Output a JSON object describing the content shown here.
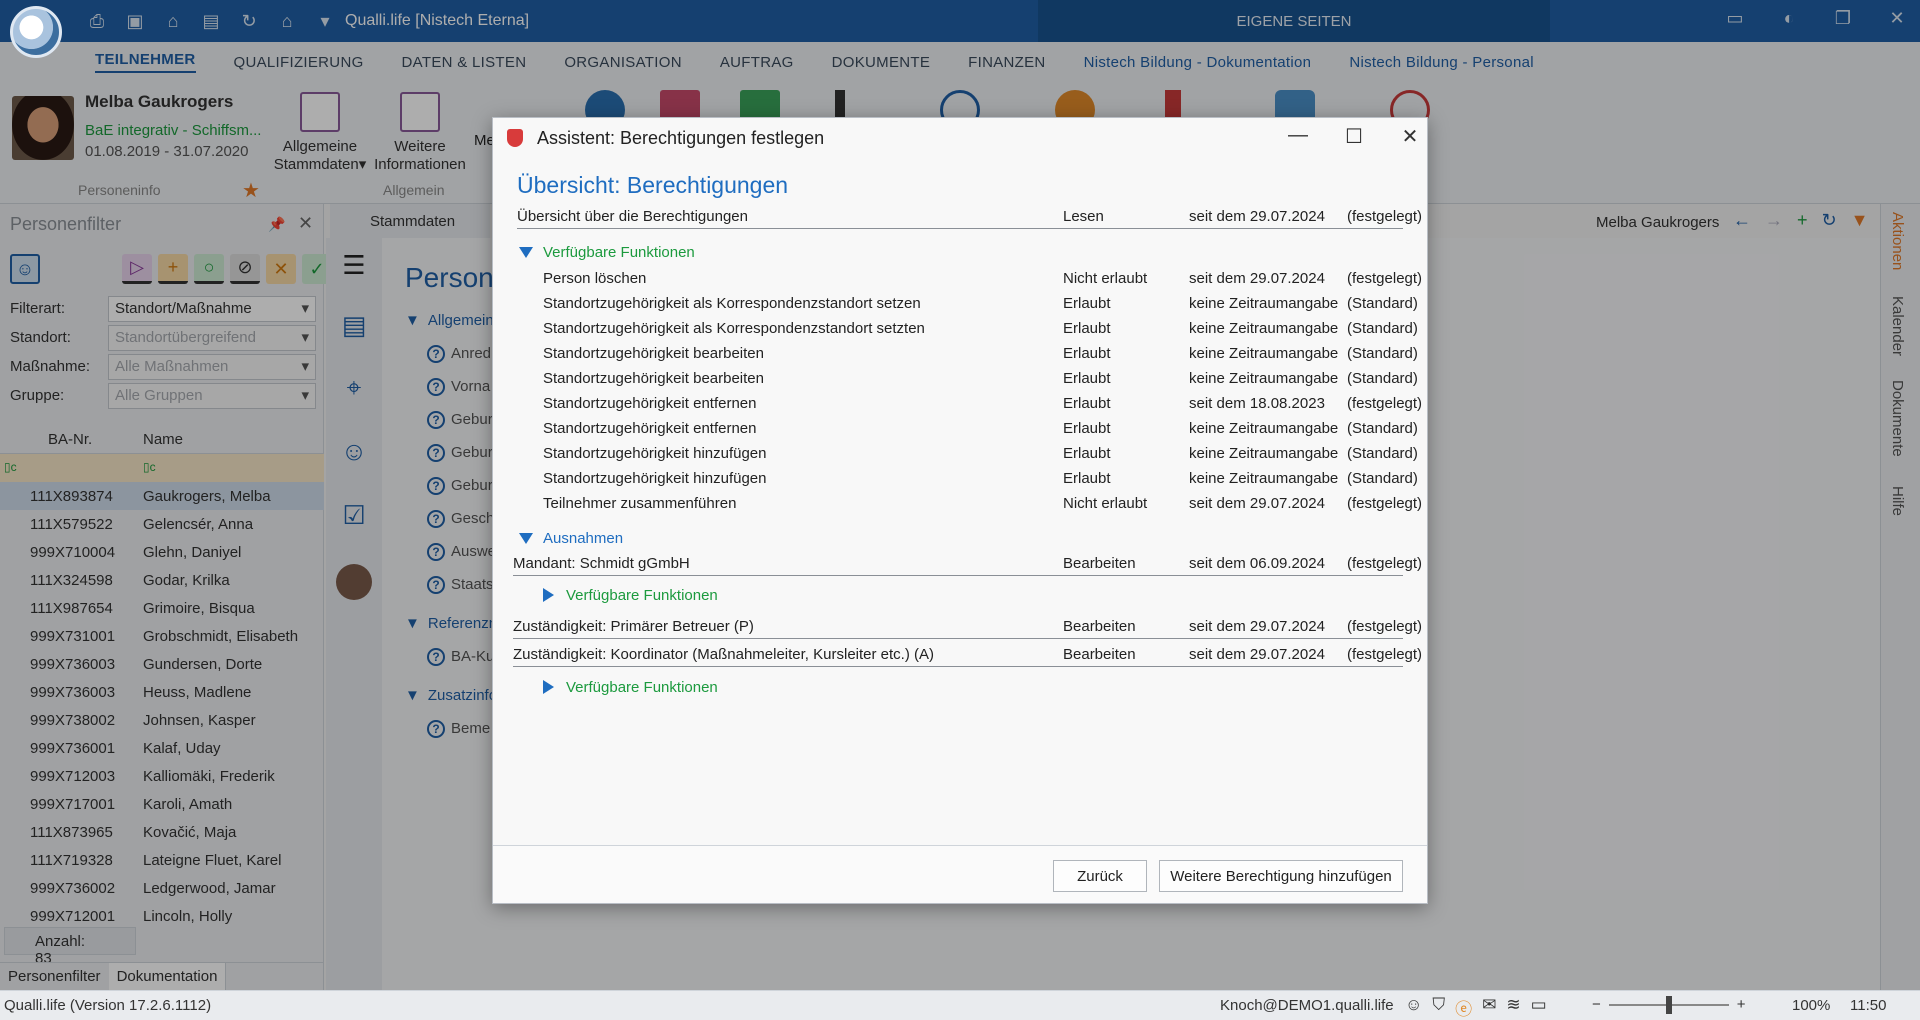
{
  "app": {
    "title": "Qualli.life [Nistech Eterna]",
    "eigene_seiten": "EIGENE SEITEN",
    "toolbar_icons": [
      "print-icon",
      "save-icon",
      "lock-icon",
      "export-icon",
      "refresh-icon",
      "home-icon",
      "dropdown-icon"
    ],
    "window_controls": [
      "layout-icon",
      "contrast-icon",
      "restore-icon",
      "close-icon"
    ]
  },
  "menu": {
    "items": [
      {
        "label": "TEILNEHMER",
        "active": true
      },
      {
        "label": "QUALIFIZIERUNG"
      },
      {
        "label": "DATEN & LISTEN"
      },
      {
        "label": "ORGANISATION"
      },
      {
        "label": "AUFTRAG"
      },
      {
        "label": "DOKUMENTE"
      },
      {
        "label": "FINANZEN"
      },
      {
        "label": "Nistech Bildung - Dokumentation",
        "blue": true
      },
      {
        "label": "Nistech Bildung - Personal",
        "blue": true
      }
    ]
  },
  "ribbon": {
    "person": {
      "name": "Melba Gaukrogers",
      "measure": "BaE integrativ - Schiffsm...",
      "period": "01.08.2019 - 31.07.2020"
    },
    "group_personeninfo": "Personeninfo",
    "group_allgemein": "Allgemein",
    "btn_allgemeine": "Allgemeine",
    "btn_stammdaten": "Stammdaten",
    "btn_weitere": "Weitere",
    "btn_informationen": "Informationen",
    "btn_partial": "Me"
  },
  "leftpanel": {
    "title": "Personenfilter",
    "filters": [
      {
        "label": "Filterart:",
        "value": "Standort/Maßnahme",
        "dim": false
      },
      {
        "label": "Standort:",
        "value": "Standortübergreifend",
        "dim": true
      },
      {
        "label": "Maßnahme:",
        "value": "Alle Maßnahmen",
        "dim": true
      },
      {
        "label": "Gruppe:",
        "value": "Alle Gruppen",
        "dim": true
      }
    ],
    "col_ba": "BA-Nr.",
    "col_name": "Name",
    "rows": [
      {
        "ba": "111X893874",
        "name": "Gaukrogers, Melba",
        "selected": true
      },
      {
        "ba": "111X579522",
        "name": "Gelencsér, Anna"
      },
      {
        "ba": "999X710004",
        "name": "Glehn, Daniyel"
      },
      {
        "ba": "111X324598",
        "name": "Godar, Krilka"
      },
      {
        "ba": "111X987654",
        "name": "Grimoire, Bisqua"
      },
      {
        "ba": "999X731001",
        "name": "Grobschmidt, Elisabeth"
      },
      {
        "ba": "999X736003",
        "name": "Gundersen, Dorte"
      },
      {
        "ba": "999X736003",
        "name": "Heuss, Madlene"
      },
      {
        "ba": "999X738002",
        "name": "Johnsen, Kasper"
      },
      {
        "ba": "999X736001",
        "name": "Kalaf, Uday"
      },
      {
        "ba": "999X712003",
        "name": "Kalliomäki, Frederik"
      },
      {
        "ba": "999X717001",
        "name": "Karoli, Amath"
      },
      {
        "ba": "111X873965",
        "name": "Kovačić, Maja"
      },
      {
        "ba": "111X719328",
        "name": "Lateigne Fluet, Karel"
      },
      {
        "ba": "999X736002",
        "name": "Ledgerwood, Jamar"
      },
      {
        "ba": "999X712001",
        "name": "Lincoln, Holly"
      }
    ],
    "count": "Anzahl: 83",
    "tab1": "Personenfilter",
    "tab2": "Dokumentation"
  },
  "main": {
    "tab_label": "Stammdaten",
    "title_partial": "Person",
    "tree": [
      {
        "type": "head",
        "label": "Allgemein"
      },
      {
        "type": "item",
        "label": "Anred"
      },
      {
        "type": "item",
        "label": "Vorna"
      },
      {
        "type": "item",
        "label": "Gebur"
      },
      {
        "type": "item",
        "label": "Gebur"
      },
      {
        "type": "item",
        "label": "Gebur"
      },
      {
        "type": "item",
        "label": "Gesch"
      },
      {
        "type": "item",
        "label": "Auswe"
      },
      {
        "type": "item",
        "label": "Staats"
      },
      {
        "type": "head",
        "label": "Referenzn"
      },
      {
        "type": "item",
        "label": "BA-Ku"
      },
      {
        "type": "head",
        "label": "Zusatzinfo"
      },
      {
        "type": "item",
        "label": "Beme"
      }
    ],
    "top_user": "Melba Gaukrogers"
  },
  "rightbar": [
    "Aktionen",
    "Kalender",
    "Dokumente",
    "Hilfe"
  ],
  "statusbar": {
    "version": "Qualli.life (Version 17.2.6.1112)",
    "user": "Knoch@DEMO1.qualli.life",
    "zoom_level": 0.5,
    "zoom": "100%",
    "time": "11:50"
  },
  "dialog": {
    "title": "Assistent: Berechtigungen festlegen",
    "heading": "Übersicht: Berechtigungen",
    "overview": {
      "name": "Übersicht über die Berechtigungen",
      "perm": "Lesen",
      "date": "seit dem 29.07.2024",
      "state": "(festgelegt)"
    },
    "section_available": "Verfügbare Funktionen",
    "functions": [
      {
        "name": "Person löschen",
        "perm": "Nicht erlaubt",
        "date": "seit dem 29.07.2024",
        "state": "(festgelegt)"
      },
      {
        "name": "Standortzugehörigkeit als Korrespondenzstandort setzen",
        "perm": "Erlaubt",
        "date": "keine Zeitraumangabe",
        "state": "(Standard)"
      },
      {
        "name": "Standortzugehörigkeit als Korrespondenzstandort setzten",
        "perm": "Erlaubt",
        "date": "keine Zeitraumangabe",
        "state": "(Standard)"
      },
      {
        "name": "Standortzugehörigkeit bearbeiten",
        "perm": "Erlaubt",
        "date": "keine Zeitraumangabe",
        "state": "(Standard)"
      },
      {
        "name": "Standortzugehörigkeit bearbeiten",
        "perm": "Erlaubt",
        "date": "keine Zeitraumangabe",
        "state": "(Standard)"
      },
      {
        "name": "Standortzugehörigkeit entfernen",
        "perm": "Erlaubt",
        "date": "seit dem 18.08.2023",
        "state": "(festgelegt)"
      },
      {
        "name": "Standortzugehörigkeit entfernen",
        "perm": "Erlaubt",
        "date": "keine Zeitraumangabe",
        "state": "(Standard)"
      },
      {
        "name": "Standortzugehörigkeit hinzufügen",
        "perm": "Erlaubt",
        "date": "keine Zeitraumangabe",
        "state": "(Standard)"
      },
      {
        "name": "Standortzugehörigkeit hinzufügen",
        "perm": "Erlaubt",
        "date": "keine Zeitraumangabe",
        "state": "(Standard)"
      },
      {
        "name": "Teilnehmer zusammenführen",
        "perm": "Nicht erlaubt",
        "date": "seit dem 29.07.2024",
        "state": "(festgelegt)"
      }
    ],
    "section_exceptions": "Ausnahmen",
    "mandant": {
      "name": "Mandant: Schmidt gGmbH",
      "perm": "Bearbeiten",
      "date": "seit dem 06.09.2024",
      "state": "(festgelegt)"
    },
    "zust1": {
      "name": "Zuständigkeit: Primärer Betreuer (P)",
      "perm": "Bearbeiten",
      "date": "seit dem 29.07.2024",
      "state": "(festgelegt)"
    },
    "zust2": {
      "name": "Zuständigkeit: Koordinator (Maßnahmeleiter, Kursleiter etc.) (A)",
      "perm": "Bearbeiten",
      "date": "seit dem 29.07.2024",
      "state": "(festgelegt)"
    },
    "btn_back": "Zurück",
    "btn_add": "Weitere Berechtigung hinzufügen"
  }
}
